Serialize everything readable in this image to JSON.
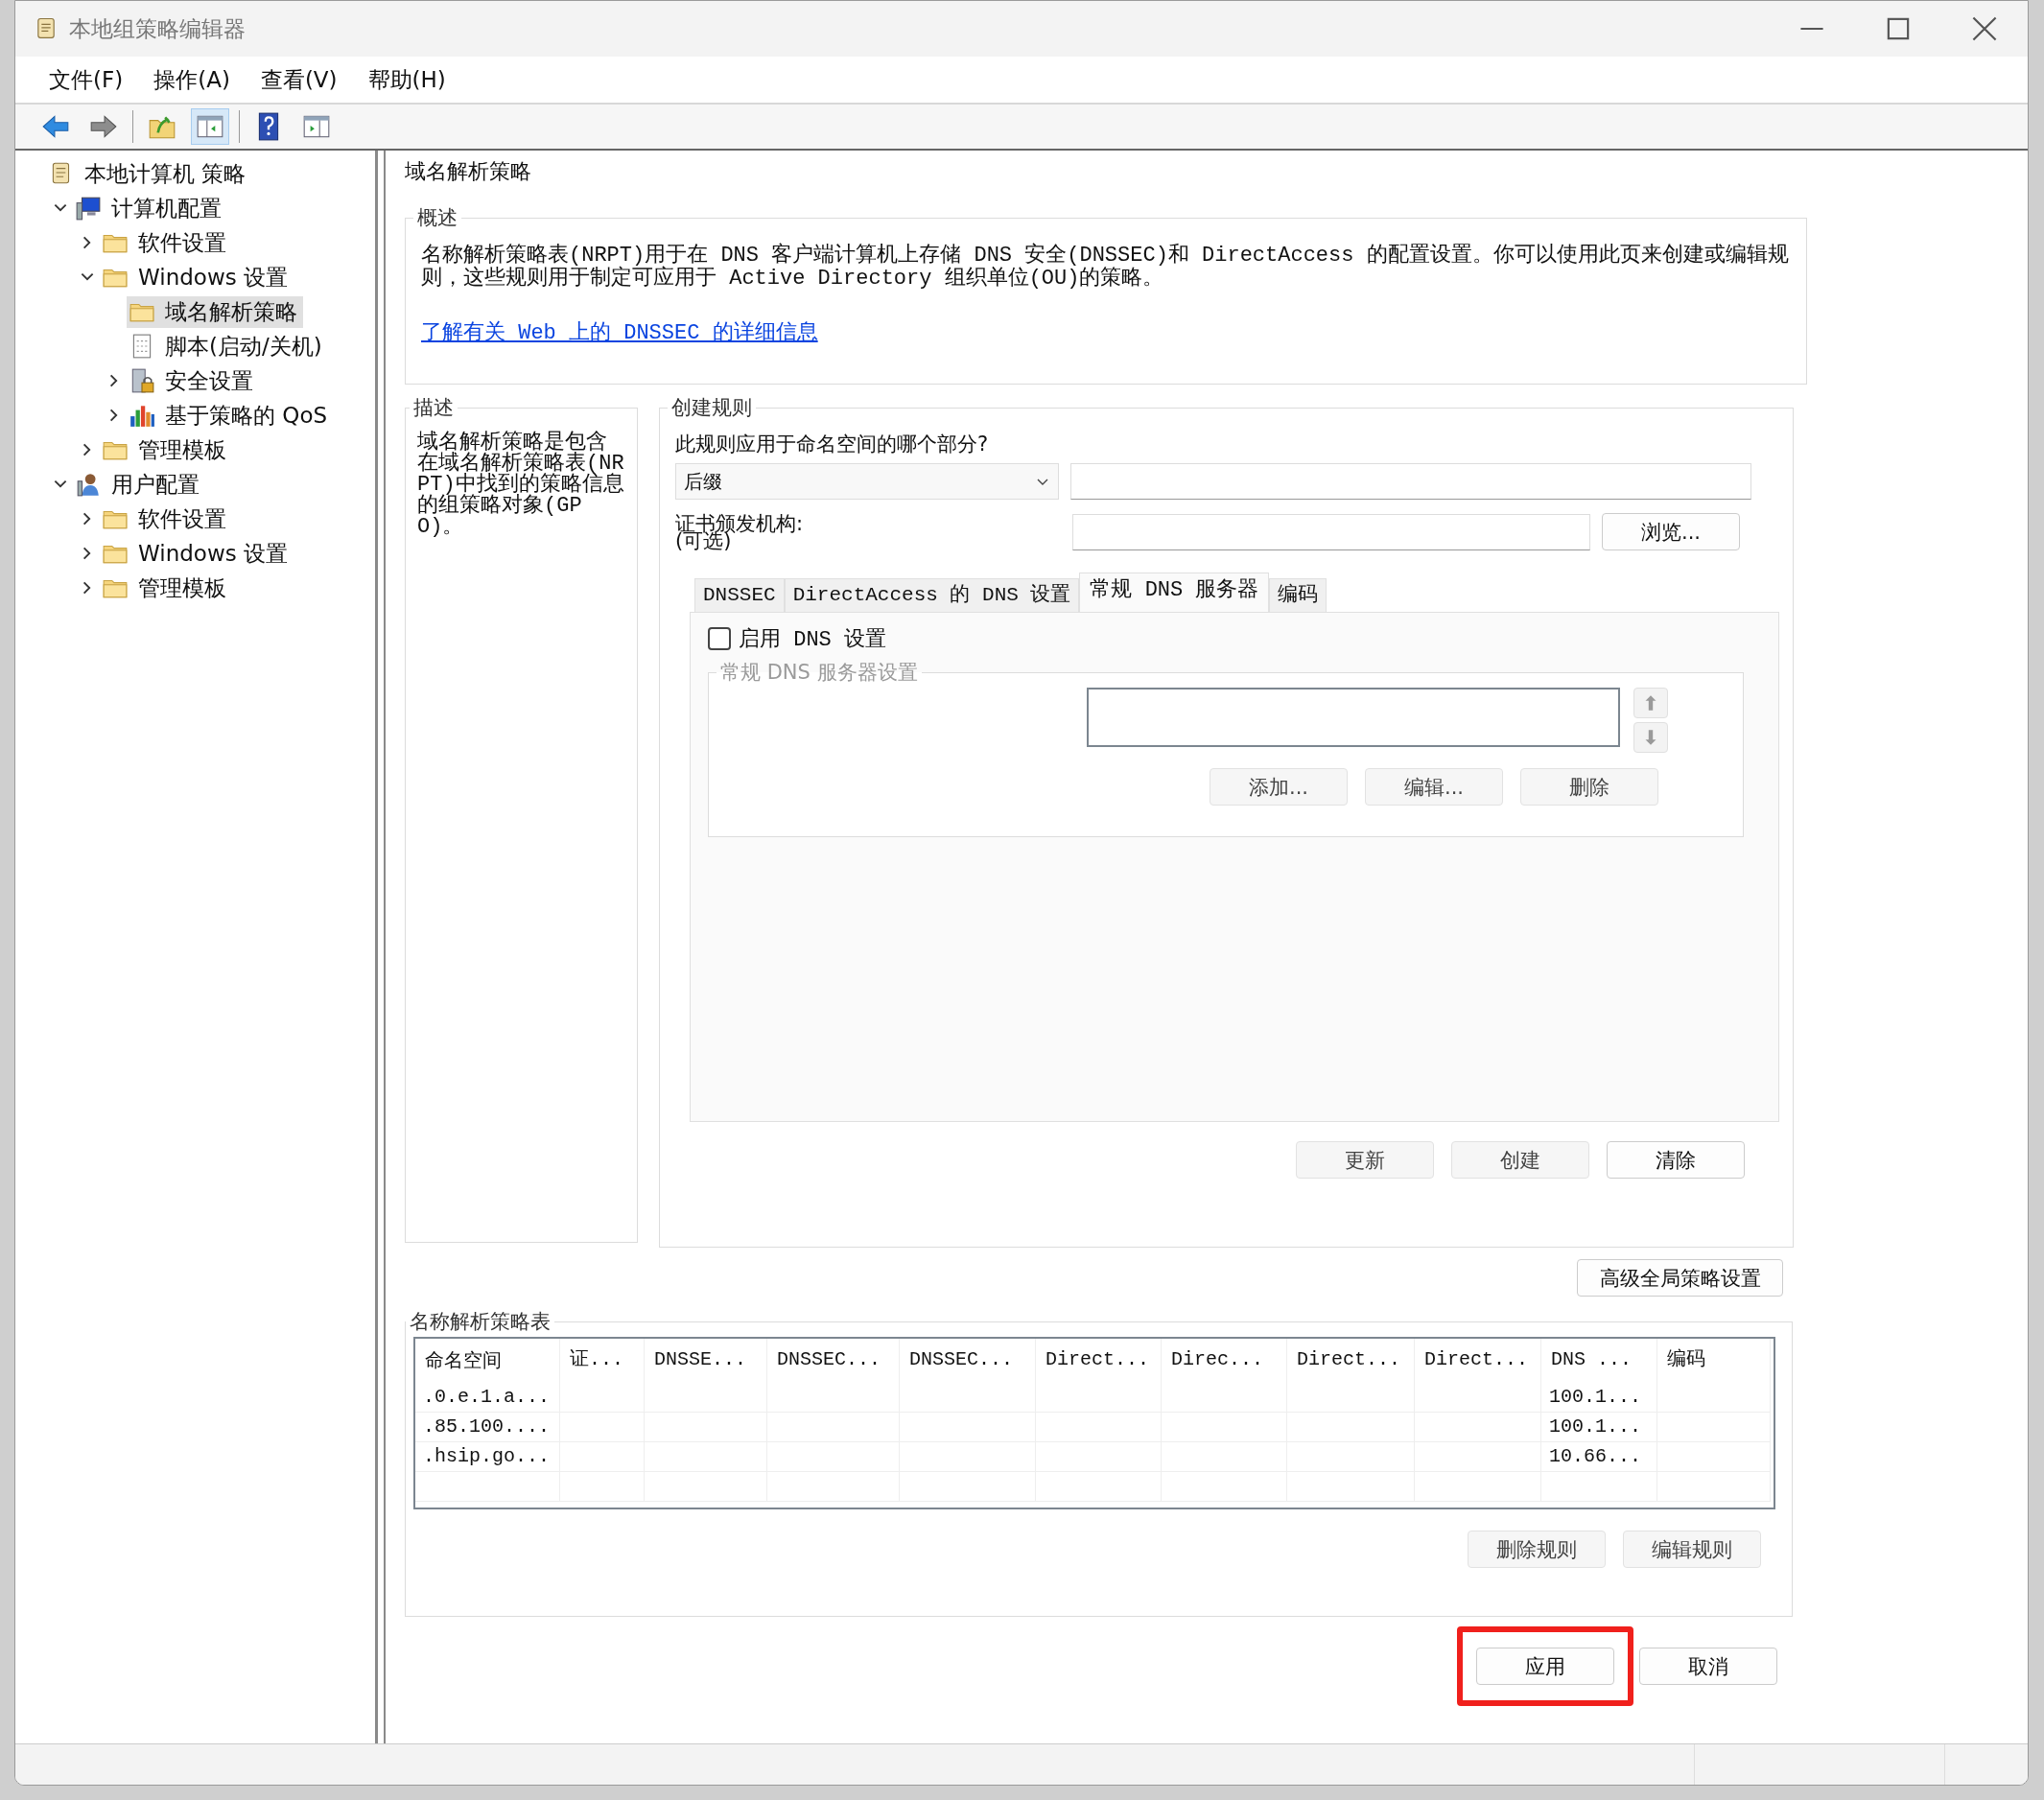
{
  "window": {
    "title": "本地组策略编辑器"
  },
  "menu": [
    "文件(F)",
    "操作(A)",
    "查看(V)",
    "帮助(H)"
  ],
  "toolbar": [
    {
      "kind": "back",
      "selected": false
    },
    {
      "kind": "forward",
      "selected": false
    },
    {
      "kind": "up",
      "selected": false
    },
    {
      "kind": "tree",
      "selected": true
    },
    {
      "kind": "help",
      "selected": false
    },
    {
      "kind": "pane",
      "selected": false
    }
  ],
  "tree": [
    {
      "label": "本地计算机 策略",
      "kind": "policy",
      "selected": false,
      "children": [
        {
          "label": "计算机配置",
          "kind": "computer",
          "selected": false,
          "expanded": true,
          "children": [
            {
              "label": "软件设置",
              "kind": "folder",
              "selected": false,
              "expanded": false
            },
            {
              "label": "Windows 设置",
              "kind": "folder",
              "selected": false,
              "expanded": true,
              "children": [
                {
                  "label": "域名解析策略",
                  "kind": "folder",
                  "selected": true
                },
                {
                  "label": "脚本(启动/关机)",
                  "kind": "script",
                  "selected": false
                },
                {
                  "label": "安全设置",
                  "kind": "security",
                  "selected": false,
                  "expanded": false
                },
                {
                  "label": "基于策略的 QoS",
                  "kind": "chart",
                  "selected": false,
                  "expanded": false
                }
              ]
            },
            {
              "label": "管理模板",
              "kind": "folder",
              "selected": false,
              "expanded": false
            }
          ]
        },
        {
          "label": "用户配置",
          "kind": "users",
          "selected": false,
          "expanded": true,
          "children": [
            {
              "label": "软件设置",
              "kind": "folder",
              "selected": false,
              "expanded": false
            },
            {
              "label": "Windows 设置",
              "kind": "folder",
              "selected": false,
              "expanded": false
            },
            {
              "label": "管理模板",
              "kind": "folder",
              "selected": false,
              "expanded": false
            }
          ]
        }
      ]
    }
  ],
  "page": {
    "title": "域名解析策略",
    "overview": {
      "legend": "概述",
      "text": "名称解析策略表(NRPT)用于在 DNS 客户端计算机上存储 DNS 安全(DNSSEC)和 DirectAccess 的配置设置。你可以使用此页来创建或编辑规则，这些规则用于制定可应用于 Active Directory 组织单位(OU)的策略。",
      "link": "了解有关 Web 上的 DNSSEC 的详细信息"
    },
    "description": {
      "legend": "描述",
      "text": "域名解析策略是包含在域名解析策略表(NRPT)中找到的策略信息的组策略对象(GPO)。"
    },
    "create_rule": {
      "legend": "创建规则",
      "question": "此规则应用于命名空间的哪个部分?",
      "namespace_type": "后缀",
      "cert_label": "证书颁发机构:",
      "cert_note": "(可选)",
      "browse": "浏览...",
      "tabs": [
        {
          "label": "DNSSEC",
          "selected": false
        },
        {
          "label": "DirectAccess 的 DNS 设置",
          "selected": false
        },
        {
          "label": "常规 DNS 服务器",
          "selected": true
        },
        {
          "label": "编码",
          "selected": false
        }
      ],
      "enable": {
        "label": "启用 DNS 设置",
        "checked": false
      },
      "server_group": {
        "legend": "常规 DNS 服务器设置",
        "disabled": true,
        "buttons": [
          "添加...",
          "编辑...",
          "删除"
        ]
      },
      "buttons": [
        "更新",
        "创建",
        "清除"
      ]
    },
    "advanced": "高级全局策略设置",
    "table": {
      "legend": "名称解析策略表",
      "columns": [
        "命名空间",
        "证...",
        "DNSSE...",
        "DNSSEC...",
        "DNSSEC...",
        "Direct...",
        "Direc...",
        "Direct...",
        "Direct...",
        "DNS ...",
        "编码"
      ],
      "rows": [
        {
          "namespace": ".0.e.1.a...",
          "dns": "100.1..."
        },
        {
          "namespace": ".85.100....",
          "dns": "100.1..."
        },
        {
          "namespace": ".hsip.go...",
          "dns": "10.66..."
        }
      ],
      "buttons": [
        "删除规则",
        "编辑规则"
      ]
    },
    "footer": [
      {
        "label": "应用",
        "highlighted": true
      },
      {
        "label": "取消",
        "highlighted": false
      }
    ]
  }
}
